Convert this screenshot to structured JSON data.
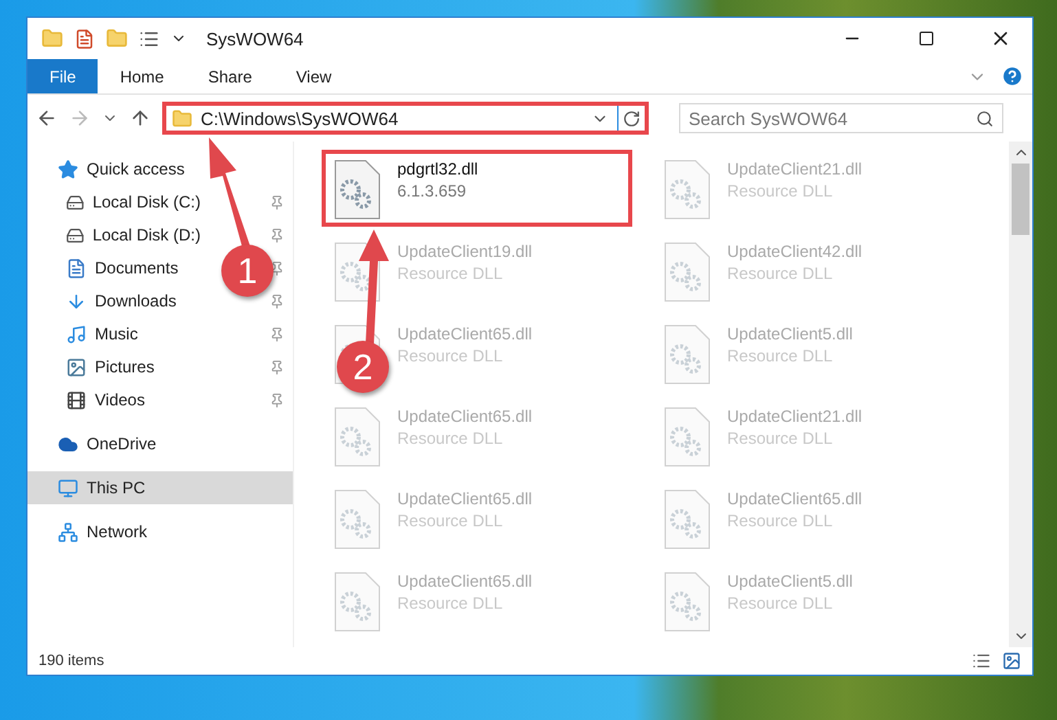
{
  "window": {
    "title": "SysWOW64"
  },
  "ribbon_tabs": [
    {
      "label": "File",
      "selected": true
    },
    {
      "label": "Home",
      "selected": false
    },
    {
      "label": "Share",
      "selected": false
    },
    {
      "label": "View",
      "selected": false
    }
  ],
  "address_bar": {
    "path": "C:\\Windows\\SysWOW64"
  },
  "search": {
    "placeholder": "Search SysWOW64"
  },
  "sidebar": {
    "items": [
      {
        "label": "Quick access",
        "kind": "star",
        "selected": false,
        "children": [
          {
            "label": "Local Disk (C:)",
            "kind": "drive",
            "pinned": true,
            "selected": false
          },
          {
            "label": "Local Disk (D:)",
            "kind": "drive",
            "pinned": true,
            "selected": false
          },
          {
            "label": "Documents",
            "kind": "document",
            "pinned": true,
            "selected": false
          },
          {
            "label": "Downloads",
            "kind": "download",
            "pinned": true,
            "selected": false
          },
          {
            "label": "Music",
            "kind": "music",
            "pinned": true,
            "selected": false
          },
          {
            "label": "Pictures",
            "kind": "picture",
            "pinned": true,
            "selected": false
          },
          {
            "label": "Videos",
            "kind": "video",
            "pinned": true,
            "selected": false
          }
        ]
      },
      {
        "label": "OneDrive",
        "kind": "cloud",
        "selected": false
      },
      {
        "label": "This PC",
        "kind": "pc",
        "selected": true
      },
      {
        "label": "Network",
        "kind": "network",
        "selected": false
      }
    ]
  },
  "files": [
    {
      "name": "pdgrtl32.dll",
      "detail": "6.1.3.659",
      "faded": false,
      "highlighted": true
    },
    {
      "name": "UpdateClient21.dll",
      "detail": "Resource DLL",
      "faded": true,
      "highlighted": false
    },
    {
      "name": "UpdateClient19.dll",
      "detail": "Resource DLL",
      "faded": true,
      "highlighted": false
    },
    {
      "name": "UpdateClient42.dll",
      "detail": "Resource DLL",
      "faded": true,
      "highlighted": false
    },
    {
      "name": "UpdateClient65.dll",
      "detail": "Resource DLL",
      "faded": true,
      "highlighted": false
    },
    {
      "name": "UpdateClient5.dll",
      "detail": "Resource DLL",
      "faded": true,
      "highlighted": false
    },
    {
      "name": "UpdateClient65.dll",
      "detail": "Resource DLL",
      "faded": true,
      "highlighted": false
    },
    {
      "name": "UpdateClient21.dll",
      "detail": "Resource DLL",
      "faded": true,
      "highlighted": false
    },
    {
      "name": "UpdateClient65.dll",
      "detail": "Resource DLL",
      "faded": true,
      "highlighted": false
    },
    {
      "name": "UpdateClient65.dll",
      "detail": "Resource DLL",
      "faded": true,
      "highlighted": false
    },
    {
      "name": "UpdateClient65.dll",
      "detail": "Resource DLL",
      "faded": true,
      "highlighted": false
    },
    {
      "name": "UpdateClient5.dll",
      "detail": "Resource DLL",
      "faded": true,
      "highlighted": false
    }
  ],
  "status_bar": {
    "count": "190 items"
  },
  "annotations": [
    {
      "number": "1"
    },
    {
      "number": "2"
    }
  ]
}
